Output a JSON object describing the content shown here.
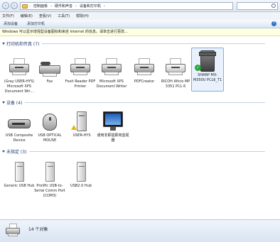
{
  "window": {
    "breadcrumbs": [
      "控制面板",
      "硬件和声音",
      "设备和打印机"
    ],
    "search_placeholder": ""
  },
  "menu": {
    "items": [
      "文件(F)",
      "编辑(E)",
      "查看(V)",
      "工具(T)",
      "帮助(H)"
    ]
  },
  "toolbar": {
    "add_device": "添加设备",
    "add_printer": "添加打印机"
  },
  "infobar": {
    "text": "Windows 可以显示增强型设备图标和来自 Internet 的信息。请单击进行更改..."
  },
  "groups": {
    "printers": {
      "title": "打印机和传真 (7)",
      "items": [
        {
          "label": "(Gray USER-HYS) Microsoft XPS Document Wri...",
          "icon": "printer-icon"
        },
        {
          "label": "Fax",
          "icon": "fax-icon"
        },
        {
          "label": "Foxit Reader PDF Printer",
          "icon": "printer-icon"
        },
        {
          "label": "Microsoft XPS Document Writer",
          "icon": "printer-icon"
        },
        {
          "label": "PDFCreator",
          "icon": "printer-icon"
        },
        {
          "label": "RICOH Aficio MP 3351 PCL 6",
          "icon": "printer-icon"
        },
        {
          "label": "SHARP MX-M350U PCL6_T1",
          "icon": "copier-icon",
          "default": true
        }
      ]
    },
    "devices": {
      "title": "设备 (4)",
      "items": [
        {
          "label": "USB Composite Device",
          "icon": "usb-device-icon"
        },
        {
          "label": "USB OPTICAL MOUSE",
          "icon": "mouse-icon"
        },
        {
          "label": "USER-HYS",
          "icon": "computer-tower-icon"
        },
        {
          "label": "通用非即插即用监视器",
          "icon": "monitor-icon"
        }
      ]
    },
    "unspecified": {
      "title": "未指定 (3)",
      "items": [
        {
          "label": "Generic USB Hub",
          "icon": "usb-hub-icon"
        },
        {
          "label": "Prolific USB-to-Serial Comm Port (COM3)",
          "icon": "usb-hub-icon"
        },
        {
          "label": "USB2.0 Hub",
          "icon": "usb-hub-icon"
        }
      ]
    }
  },
  "status": {
    "count_text": "14 个对象"
  }
}
